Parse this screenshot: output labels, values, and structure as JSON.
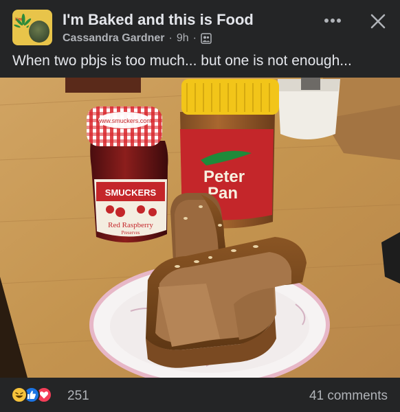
{
  "header": {
    "group_name": "I'm Baked and this is Food",
    "author": "Cassandra Gardner",
    "time": "9h",
    "separator": "·",
    "privacy_icon": "group-members-icon",
    "more_icon": "more-dots-icon",
    "close_icon": "close-icon"
  },
  "post": {
    "caption": "When two pbjs is too much... but one is not enough..."
  },
  "photo": {
    "jar_lid_text": "www.smuckers.com",
    "jar_brand": "SMUCKERS",
    "jar_flavor": "Red Raspberry",
    "jar_type": "Preserves",
    "pb_brand": "Peter Pan"
  },
  "footer": {
    "reaction_icons": [
      "haha-icon",
      "like-icon",
      "love-icon"
    ],
    "reaction_count": "251",
    "comments": "41 comments"
  },
  "colors": {
    "background": "#242526",
    "text": "#e4e6eb",
    "secondary_text": "#b0b3b8",
    "like_blue": "#1b74e4",
    "love_red": "#f33e58",
    "haha_yellow": "#f7c33b"
  }
}
